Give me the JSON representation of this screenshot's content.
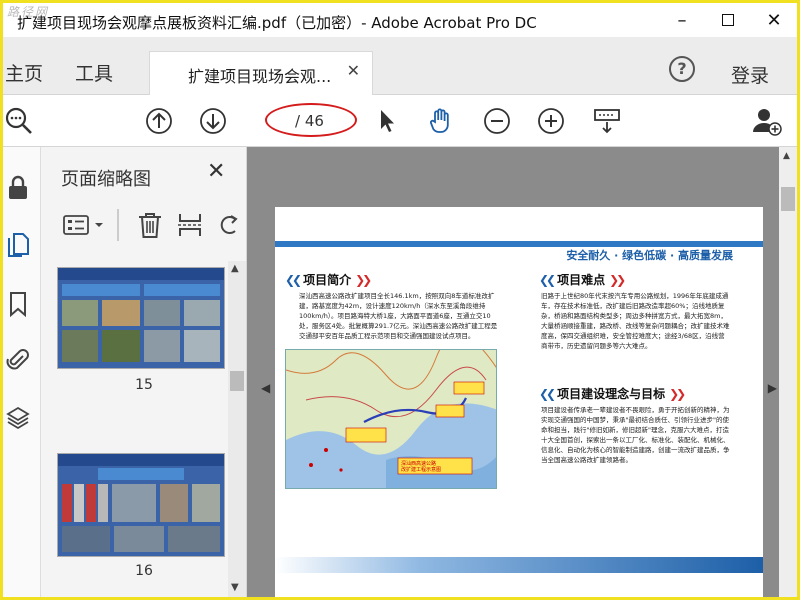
{
  "window": {
    "watermark": "路径网",
    "title": "扩建项目现场会观摩点展板资料汇编.pdf（已加密）- Adobe Acrobat Pro DC"
  },
  "tabs": {
    "home": "主页",
    "tools": "工具",
    "doc": "扩建项目现场会观...",
    "login": "登录"
  },
  "toolbar": {
    "page_text": "/ 46"
  },
  "panel": {
    "title": "页面缩略图",
    "thumbs": [
      {
        "label": "15"
      },
      {
        "label": "16"
      }
    ]
  },
  "page": {
    "slogan": "安全耐久 · 绿色低碳 · 高质量发展",
    "sec1_title": "项目简介",
    "sec2_title": "项目难点",
    "sec3_title": "项目建设理念与目标",
    "sec1_text": "深汕西高速公路改扩建项目全长146.1km，按照双向8车道标准改扩建，路基宽度为42m，设计速度120km/h（深水东至溪角段维持100km/h）。项目路海特大桥1座，大路面平面道6座，互通立交10处，服务区4处。批复概算291.7亿元。深汕西高速公路改扩建工程是交通部平安百年品质工程示范项目和交通强国建设试点项目。",
    "sec2_text": "旧路于上世纪80年代末按汽车专用公路规划，1996年年底建成通车，存在技术标准低，改扩建后旧路改造率超60%；沿线地质复杂，桥涵和路面结构类型多；周边多种拼宽方式，最大拓宽8m，大量桥涵顺接重建，路改桥、改线等复杂问题耦合；改扩建技术难度高，保四交通组织难，安全管控难度大；途经3/68区，沿线营商带市，历史遗留问题多等六大难点。",
    "sec3_text": "项目建设者传承老一辈建设者不畏艰险，勇于开拓创新的精神，为实现交通强国的中国梦，秉承\"最初结合质任、引领行业进步\"的使命和担当，践行\"修旧如新，修旧超新\"理念，克服六大难点，打造十大全国首创，探索出一条以工厂化、标准化、装配化、机械化、信息化、自动化为核心的智能制造建路，创建一流改扩建品质，争当全国高速公路改扩建领路者。",
    "map_labels": [
      "深汕西高速公路",
      "改扩建工程示意图"
    ]
  },
  "colors": {
    "accent_blue": "#1d5fa8",
    "accent_red": "#d42a2a",
    "highlight_ellipse": "#d41c1c"
  }
}
